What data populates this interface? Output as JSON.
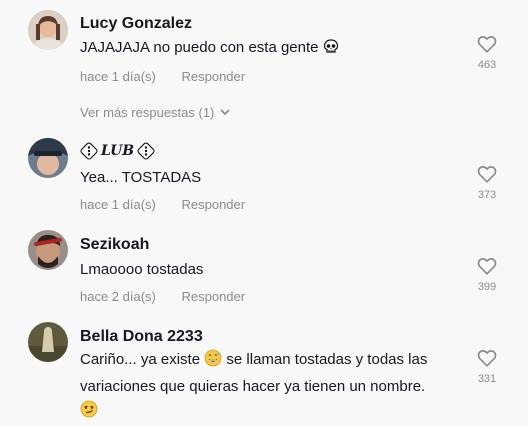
{
  "comments": [
    {
      "username": "Lucy Gonzalez",
      "text": "JAJAJAJA no puedo con esta gente",
      "emoji": "skull",
      "time": "hace 1 día(s)",
      "reply": "Responder",
      "likes": "463",
      "view_more": "Ver más respuestas (1)"
    },
    {
      "username": "LUB",
      "text": "Yea... TOSTADAS",
      "time": "hace 1 día(s)",
      "reply": "Responder",
      "likes": "373"
    },
    {
      "username": "Sezikoah",
      "text": "Lmaoooo tostadas",
      "time": "hace 2 día(s)",
      "reply": "Responder",
      "likes": "399"
    },
    {
      "username": "Bella Dona 2233",
      "text_part1": "Cariño... ya existe",
      "text_part2": "se llaman tostadas y todas las variaciones que quieras hacer ya tienen un nombre.",
      "time": "",
      "likes": "331"
    }
  ],
  "icons": {
    "like": "heart-outline-icon",
    "expand": "chevron-down-icon"
  },
  "colors": {
    "text": "#161823",
    "secondary": "#8a8b91",
    "background": "#f8f8f8"
  }
}
